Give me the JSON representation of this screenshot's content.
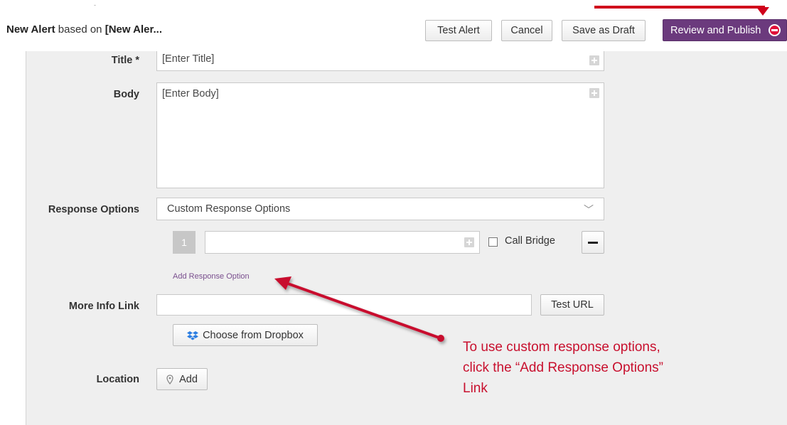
{
  "header": {
    "tiny_mark": "-",
    "heading_prefix": "New Alert",
    "heading_mid": " based on ",
    "heading_suffix": "[New Aler...",
    "buttons": {
      "test_alert": "Test Alert",
      "cancel": "Cancel",
      "save_draft": "Save as Draft",
      "publish": "Review and Publish"
    }
  },
  "form": {
    "title": {
      "label": "Title *",
      "value": "[Enter Title]"
    },
    "body": {
      "label": "Body",
      "value": "[Enter Body]"
    },
    "response_options": {
      "label": "Response Options",
      "selected": "Custom Response Options",
      "items": [
        {
          "number": "1",
          "value": "",
          "call_bridge_label": "Call Bridge",
          "call_bridge_checked": false
        }
      ],
      "add_link": "Add Response Option"
    },
    "more_info": {
      "label": "More Info Link",
      "value": "",
      "test_url": "Test URL",
      "dropbox": "Choose from Dropbox"
    },
    "location": {
      "label": "Location",
      "add": "Add"
    }
  },
  "annotation": {
    "lines": [
      "To use custom response options,",
      "click the “Add Response Options”",
      "Link"
    ],
    "color": "#c8102e"
  },
  "colors": {
    "publish_bg": "#6b3a7d",
    "panel_bg": "#efefef",
    "link": "#7a4f8e",
    "callout_red": "#d0021b"
  },
  "icons": {
    "publish_stop": "minus-circle-icon",
    "plus": "plus-square-icon",
    "chevron": "chevron-down-icon",
    "dropbox": "dropbox-icon",
    "location": "map-pin-icon",
    "remove": "minus-icon"
  }
}
